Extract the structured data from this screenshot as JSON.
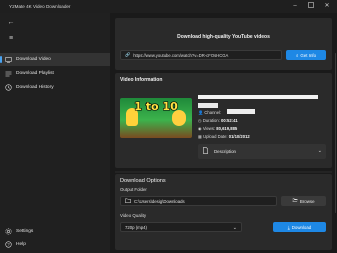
{
  "window": {
    "title": "Y2Mate 4K Video Downloader",
    "controls": [
      "minimize",
      "maximize",
      "close"
    ]
  },
  "sidebar": {
    "items": [
      {
        "label": "Download Video",
        "icon": "monitor-icon",
        "active": true
      },
      {
        "label": "Download Playlist",
        "icon": "playlist-icon",
        "active": false
      },
      {
        "label": "Download History",
        "icon": "history-icon",
        "active": false
      }
    ],
    "footer": [
      {
        "label": "Settings",
        "icon": "gear-icon"
      },
      {
        "label": "Help",
        "icon": "help-icon"
      }
    ]
  },
  "main": {
    "header": "Download high-quality YouTube videos",
    "url_value": "https://www.youtube.com/watch?v=DR-cFOsHCGA",
    "get_info_label": "Get Info",
    "video_info": {
      "title": "Video Information",
      "thumbnail_text": "1 to 10",
      "channel_label": "Channel:",
      "duration_label": "Duration:",
      "duration": "00:52:41",
      "views_label": "Views:",
      "views": "80,619,885",
      "upload_label": "Upload Date:",
      "upload_date": "01/10/2012",
      "description_label": "Description"
    },
    "download_options": {
      "title": "Download Options",
      "output_label": "Output Folder",
      "output_value": "C:\\Users\\desig\\Downloads",
      "browse_label": "Browse",
      "quality_label": "Video Quality",
      "quality_value": "720p (mp4)",
      "download_label": "Download"
    }
  },
  "colors": {
    "accent": "#1e88e5",
    "background": "#1a1a1a",
    "card": "#2a2a2a"
  }
}
